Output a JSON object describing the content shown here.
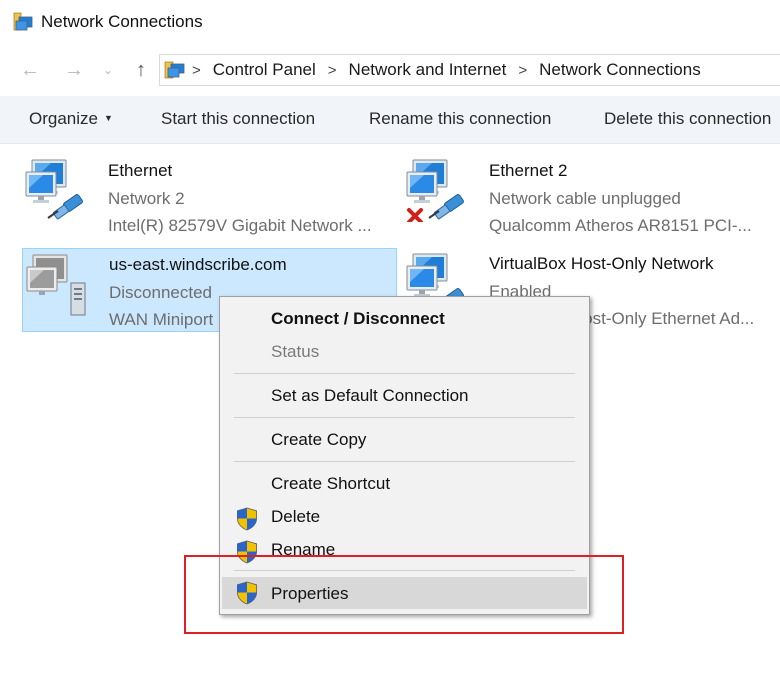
{
  "window": {
    "title": "Network Connections",
    "icon": "network-connections-icon"
  },
  "nav": {
    "back_icon": "arrow-left-icon",
    "forward_icon": "arrow-right-icon",
    "recent_icon": "chevron-down-icon",
    "up_icon": "arrow-up-icon",
    "breadcrumbs": [
      "Control Panel",
      "Network and Internet",
      "Network Connections"
    ]
  },
  "commandbar": {
    "organize": "Organize",
    "start": "Start this connection",
    "rename": "Rename this connection",
    "delete": "Delete this connection"
  },
  "items": [
    {
      "name": "Ethernet",
      "status": "Network  2",
      "device": "Intel(R) 82579V Gigabit Network ...",
      "icon": "ethernet-adapter-icon"
    },
    {
      "name": "Ethernet 2",
      "status": "Network cable unplugged",
      "device": "Qualcomm Atheros AR8151 PCI-...",
      "icon": "ethernet-adapter-unplugged-icon"
    },
    {
      "name": "us-east.windscribe.com",
      "status": "Disconnected",
      "device": "WAN Miniport",
      "icon": "vpn-connection-icon",
      "selected": true
    },
    {
      "name": "VirtualBox Host-Only Network",
      "status": "Enabled",
      "device": "VirtualBox Host-Only Ethernet Ad...",
      "icon": "ethernet-adapter-icon"
    }
  ],
  "context_menu": {
    "connect": "Connect / Disconnect",
    "status": "Status",
    "set_default": "Set as Default Connection",
    "create_copy": "Create Copy",
    "create_shortcut": "Create Shortcut",
    "delete": "Delete",
    "rename": "Rename",
    "properties": "Properties"
  },
  "colors": {
    "selection": "#cce8ff",
    "menu_highlight": "#d8d8d8",
    "annotation": "#e02020",
    "shield_blue": "#2a66c7",
    "shield_yellow": "#f2c200"
  }
}
